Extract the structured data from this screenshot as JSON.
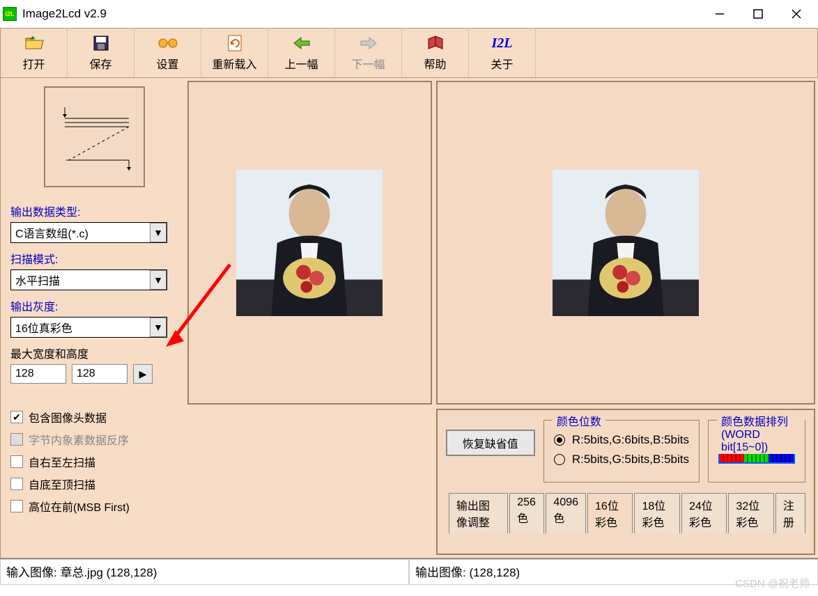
{
  "titlebar": {
    "title": "Image2Lcd v2.9",
    "app_icon_text": "I2L"
  },
  "toolbar": {
    "open": "打开",
    "save": "保存",
    "settings": "设置",
    "reload": "重新载入",
    "prev": "上一幅",
    "next": "下一幅",
    "help": "帮助",
    "about": "关于",
    "about_icon_text": "I2L"
  },
  "sidebar": {
    "output_type_label": "输出数据类型:",
    "output_type_value": "C语言数组(*.c)",
    "scan_mode_label": "扫描模式:",
    "scan_mode_value": "水平扫描",
    "output_gray_label": "输出灰度:",
    "output_gray_value": "16位真彩色",
    "max_size_label": "最大宽度和高度",
    "width": "128",
    "height": "128",
    "checks": {
      "header": "包含图像头数据",
      "reverse": "字节内象素数据反序",
      "rtl": "自右至左扫描",
      "btt": "自底至顶扫描",
      "msb": "高位在前(MSB First)"
    }
  },
  "bottom": {
    "restore": "恢复缺省值",
    "color_bits_legend": "颜色位数",
    "radio1": "R:5bits,G:6bits,B:5bits",
    "radio2": "R:5bits,G:5bits,B:5bits",
    "color_order_legend": "颜色数据排列(WORD bit[15~0])",
    "tabs": [
      "输出图像调整",
      "256色",
      "4096色",
      "16位彩色",
      "18位彩色",
      "24位彩色",
      "32位彩色",
      "注册"
    ]
  },
  "status": {
    "input": "输入图像: 章总.jpg (128,128)",
    "output": "输出图像: (128,128)"
  },
  "watermark": "CSDN @祝老师"
}
